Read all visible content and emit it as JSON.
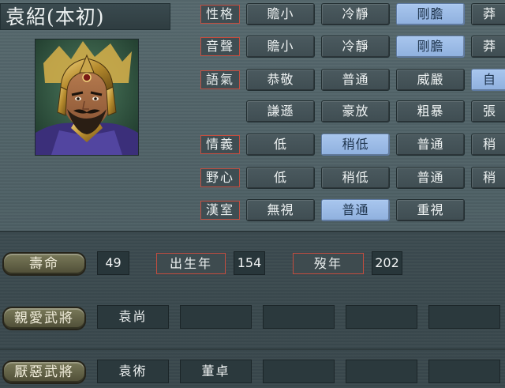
{
  "character": {
    "name": "袁紹(本初)"
  },
  "personality": {
    "rows": [
      {
        "label": "性格",
        "options": [
          "贍小",
          "冷靜",
          "剛膽",
          "莽"
        ],
        "selected": 2
      },
      {
        "label": "音聲",
        "options": [
          "贍小",
          "冷靜",
          "剛膽",
          "莽"
        ],
        "selected": 2
      },
      {
        "label": "語氣",
        "options": [
          "恭敬",
          "普通",
          "威嚴",
          "自"
        ],
        "selected": 3
      },
      {
        "label": "",
        "options": [
          "謙遜",
          "豪放",
          "粗暴",
          "張"
        ],
        "selected": -1
      },
      {
        "label": "情義",
        "options": [
          "低",
          "稍低",
          "普通",
          "稍"
        ],
        "selected": 1
      },
      {
        "label": "野心",
        "options": [
          "低",
          "稍低",
          "普通",
          "稍"
        ],
        "selected": -1
      },
      {
        "label": "漢室",
        "options": [
          "無視",
          "普通",
          "重視"
        ],
        "selected": 1
      }
    ]
  },
  "stats": {
    "lifespan_label": "壽命",
    "lifespan_value": "49",
    "birth_label": "出生年",
    "birth_value": "154",
    "death_label": "歿年",
    "death_value": "202"
  },
  "relations": {
    "favored_label": "親愛武將",
    "favored": [
      "袁尚",
      "",
      "",
      "",
      ""
    ],
    "disliked_label": "厭惡武將",
    "disliked": [
      "袁術",
      "董卓",
      "",
      "",
      ""
    ]
  },
  "colors": {
    "selected_option": "#9dbde8",
    "label_border": "#c44d3f",
    "panel": "#4f6166"
  }
}
